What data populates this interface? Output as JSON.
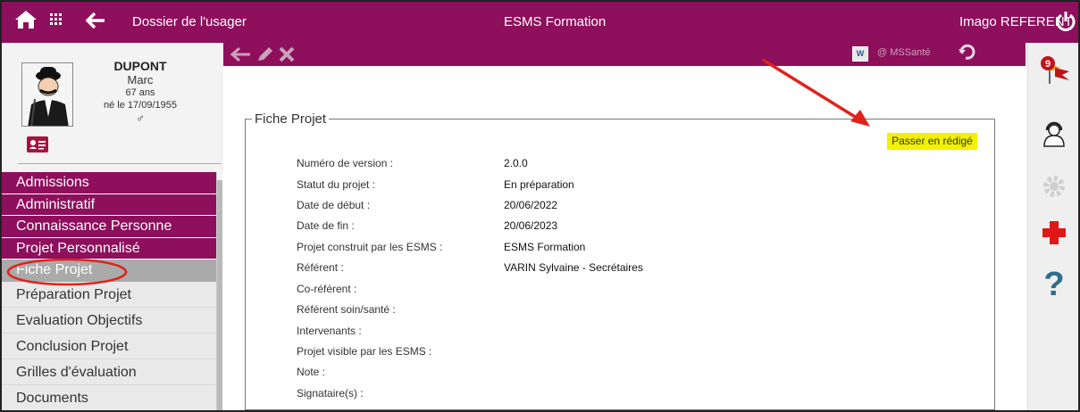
{
  "topbar": {
    "left_title": "Dossier de l'usager",
    "center_title": "ESMS Formation",
    "user_label": "Imago REFERENT"
  },
  "patient": {
    "last_name": "DUPONT",
    "first_name": "Marc",
    "age": "67 ans",
    "birth": "né le 17/09/1955",
    "sex_symbol": "♂"
  },
  "nav": {
    "items": [
      {
        "label": "Admissions"
      },
      {
        "label": "Administratif"
      },
      {
        "label": "Connaissance Personne"
      },
      {
        "label": "Projet Personnalisé"
      },
      {
        "label": "Fiche Projet"
      },
      {
        "label": "Préparation Projet"
      },
      {
        "label": "Evaluation Objectifs"
      },
      {
        "label": "Conclusion Projet"
      },
      {
        "label": "Grilles d'évaluation"
      },
      {
        "label": "Documents"
      }
    ],
    "active_index": 4
  },
  "toolbar": {
    "word_label": "W",
    "messaging_label": "@ MSSanté"
  },
  "fiche": {
    "legend": "Fiche Projet",
    "action_button": "Passer en rédigé",
    "fields": [
      {
        "label": "Numéro de version :",
        "value": "2.0.0"
      },
      {
        "label": "Statut du projet :",
        "value": "En préparation"
      },
      {
        "label": "Date de début :",
        "value": "20/06/2022"
      },
      {
        "label": "Date de fin :",
        "value": "20/06/2023"
      },
      {
        "label": "Projet construit par les ESMS :",
        "value": "ESMS Formation"
      },
      {
        "label": "Référent :",
        "value": "VARIN Sylvaine - Secrétaires"
      },
      {
        "label": "Co-référent :",
        "value": ""
      },
      {
        "label": "Référent soin/santé :",
        "value": ""
      },
      {
        "label": "Intervenants :",
        "value": ""
      },
      {
        "label": "Projet visible par les ESMS :",
        "value": ""
      },
      {
        "label": "Note :",
        "value": ""
      },
      {
        "label": "Signataire(s) :",
        "value": ""
      }
    ]
  },
  "rightbar": {
    "notification_count": "9",
    "help_symbol": "?"
  },
  "colors": {
    "brand": "#8e0f5c",
    "highlight": "#f3f000",
    "annotation": "#e0221b"
  }
}
